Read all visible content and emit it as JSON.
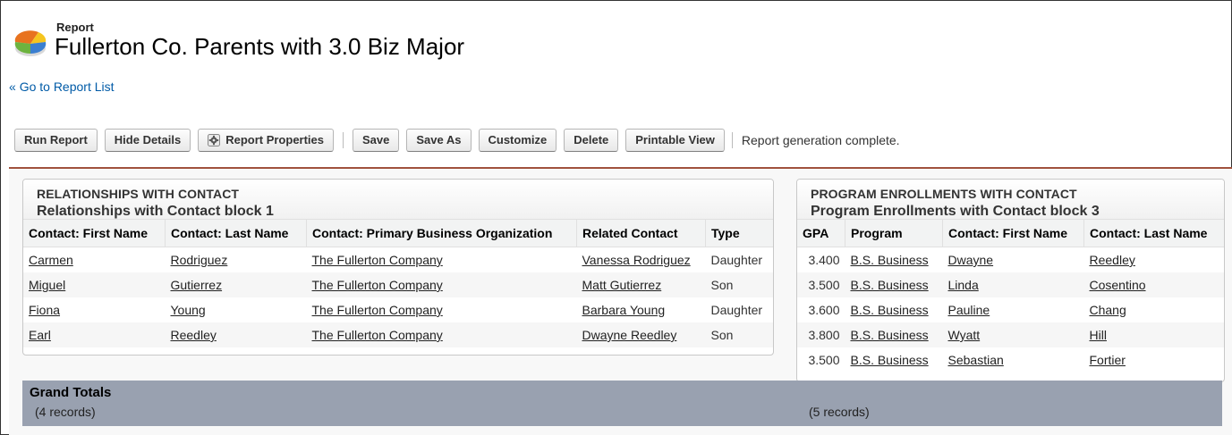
{
  "header": {
    "kicker": "Report",
    "title": "Fullerton Co. Parents with 3.0 Biz Major",
    "back_link": "Go to Report List",
    "back_prefix": "«"
  },
  "toolbar": {
    "run": "Run Report",
    "hide": "Hide Details",
    "props": "Report Properties",
    "save": "Save",
    "save_as": "Save As",
    "customize": "Customize",
    "delete": "Delete",
    "printable": "Printable View",
    "status": "Report generation complete."
  },
  "block1": {
    "caption": "RELATIONSHIPS WITH CONTACT",
    "subtitle": "Relationships with Contact block 1",
    "columns": [
      "Contact: First Name",
      "Contact: Last Name",
      "Contact: Primary Business Organization",
      "Related Contact",
      "Type"
    ],
    "rows": [
      [
        "Carmen",
        "Rodriguez",
        "The Fullerton Company",
        "Vanessa Rodriguez",
        "Daughter"
      ],
      [
        "Miguel",
        "Gutierrez",
        "The Fullerton Company",
        "Matt Gutierrez",
        "Son"
      ],
      [
        "Fiona",
        "Young",
        "The Fullerton Company",
        "Barbara Young",
        "Daughter"
      ],
      [
        "Earl",
        "Reedley",
        "The Fullerton Company",
        "Dwayne Reedley",
        "Son"
      ]
    ]
  },
  "block3": {
    "caption": "PROGRAM ENROLLMENTS WITH CONTACT",
    "subtitle": "Program Enrollments with Contact block 3",
    "columns": [
      "GPA",
      "Program",
      "Contact: First Name",
      "Contact: Last Name"
    ],
    "rows": [
      [
        "3.400",
        "B.S. Business",
        "Dwayne",
        "Reedley"
      ],
      [
        "3.500",
        "B.S. Business",
        "Linda",
        "Cosentino"
      ],
      [
        "3.600",
        "B.S. Business",
        "Pauline",
        "Chang"
      ],
      [
        "3.800",
        "B.S. Business",
        "Wyatt",
        "Hill"
      ],
      [
        "3.500",
        "B.S. Business",
        "Sebastian",
        "Fortier"
      ]
    ]
  },
  "totals": {
    "label": "Grand Totals",
    "left": "(4 records)",
    "right": "(5 records)"
  },
  "colors": {
    "divider": "#a0523d",
    "totals_bg": "#99a1b0",
    "link": "#015ba7"
  },
  "icons": {
    "report": "report-pie-icon",
    "gear": "gear-icon"
  }
}
